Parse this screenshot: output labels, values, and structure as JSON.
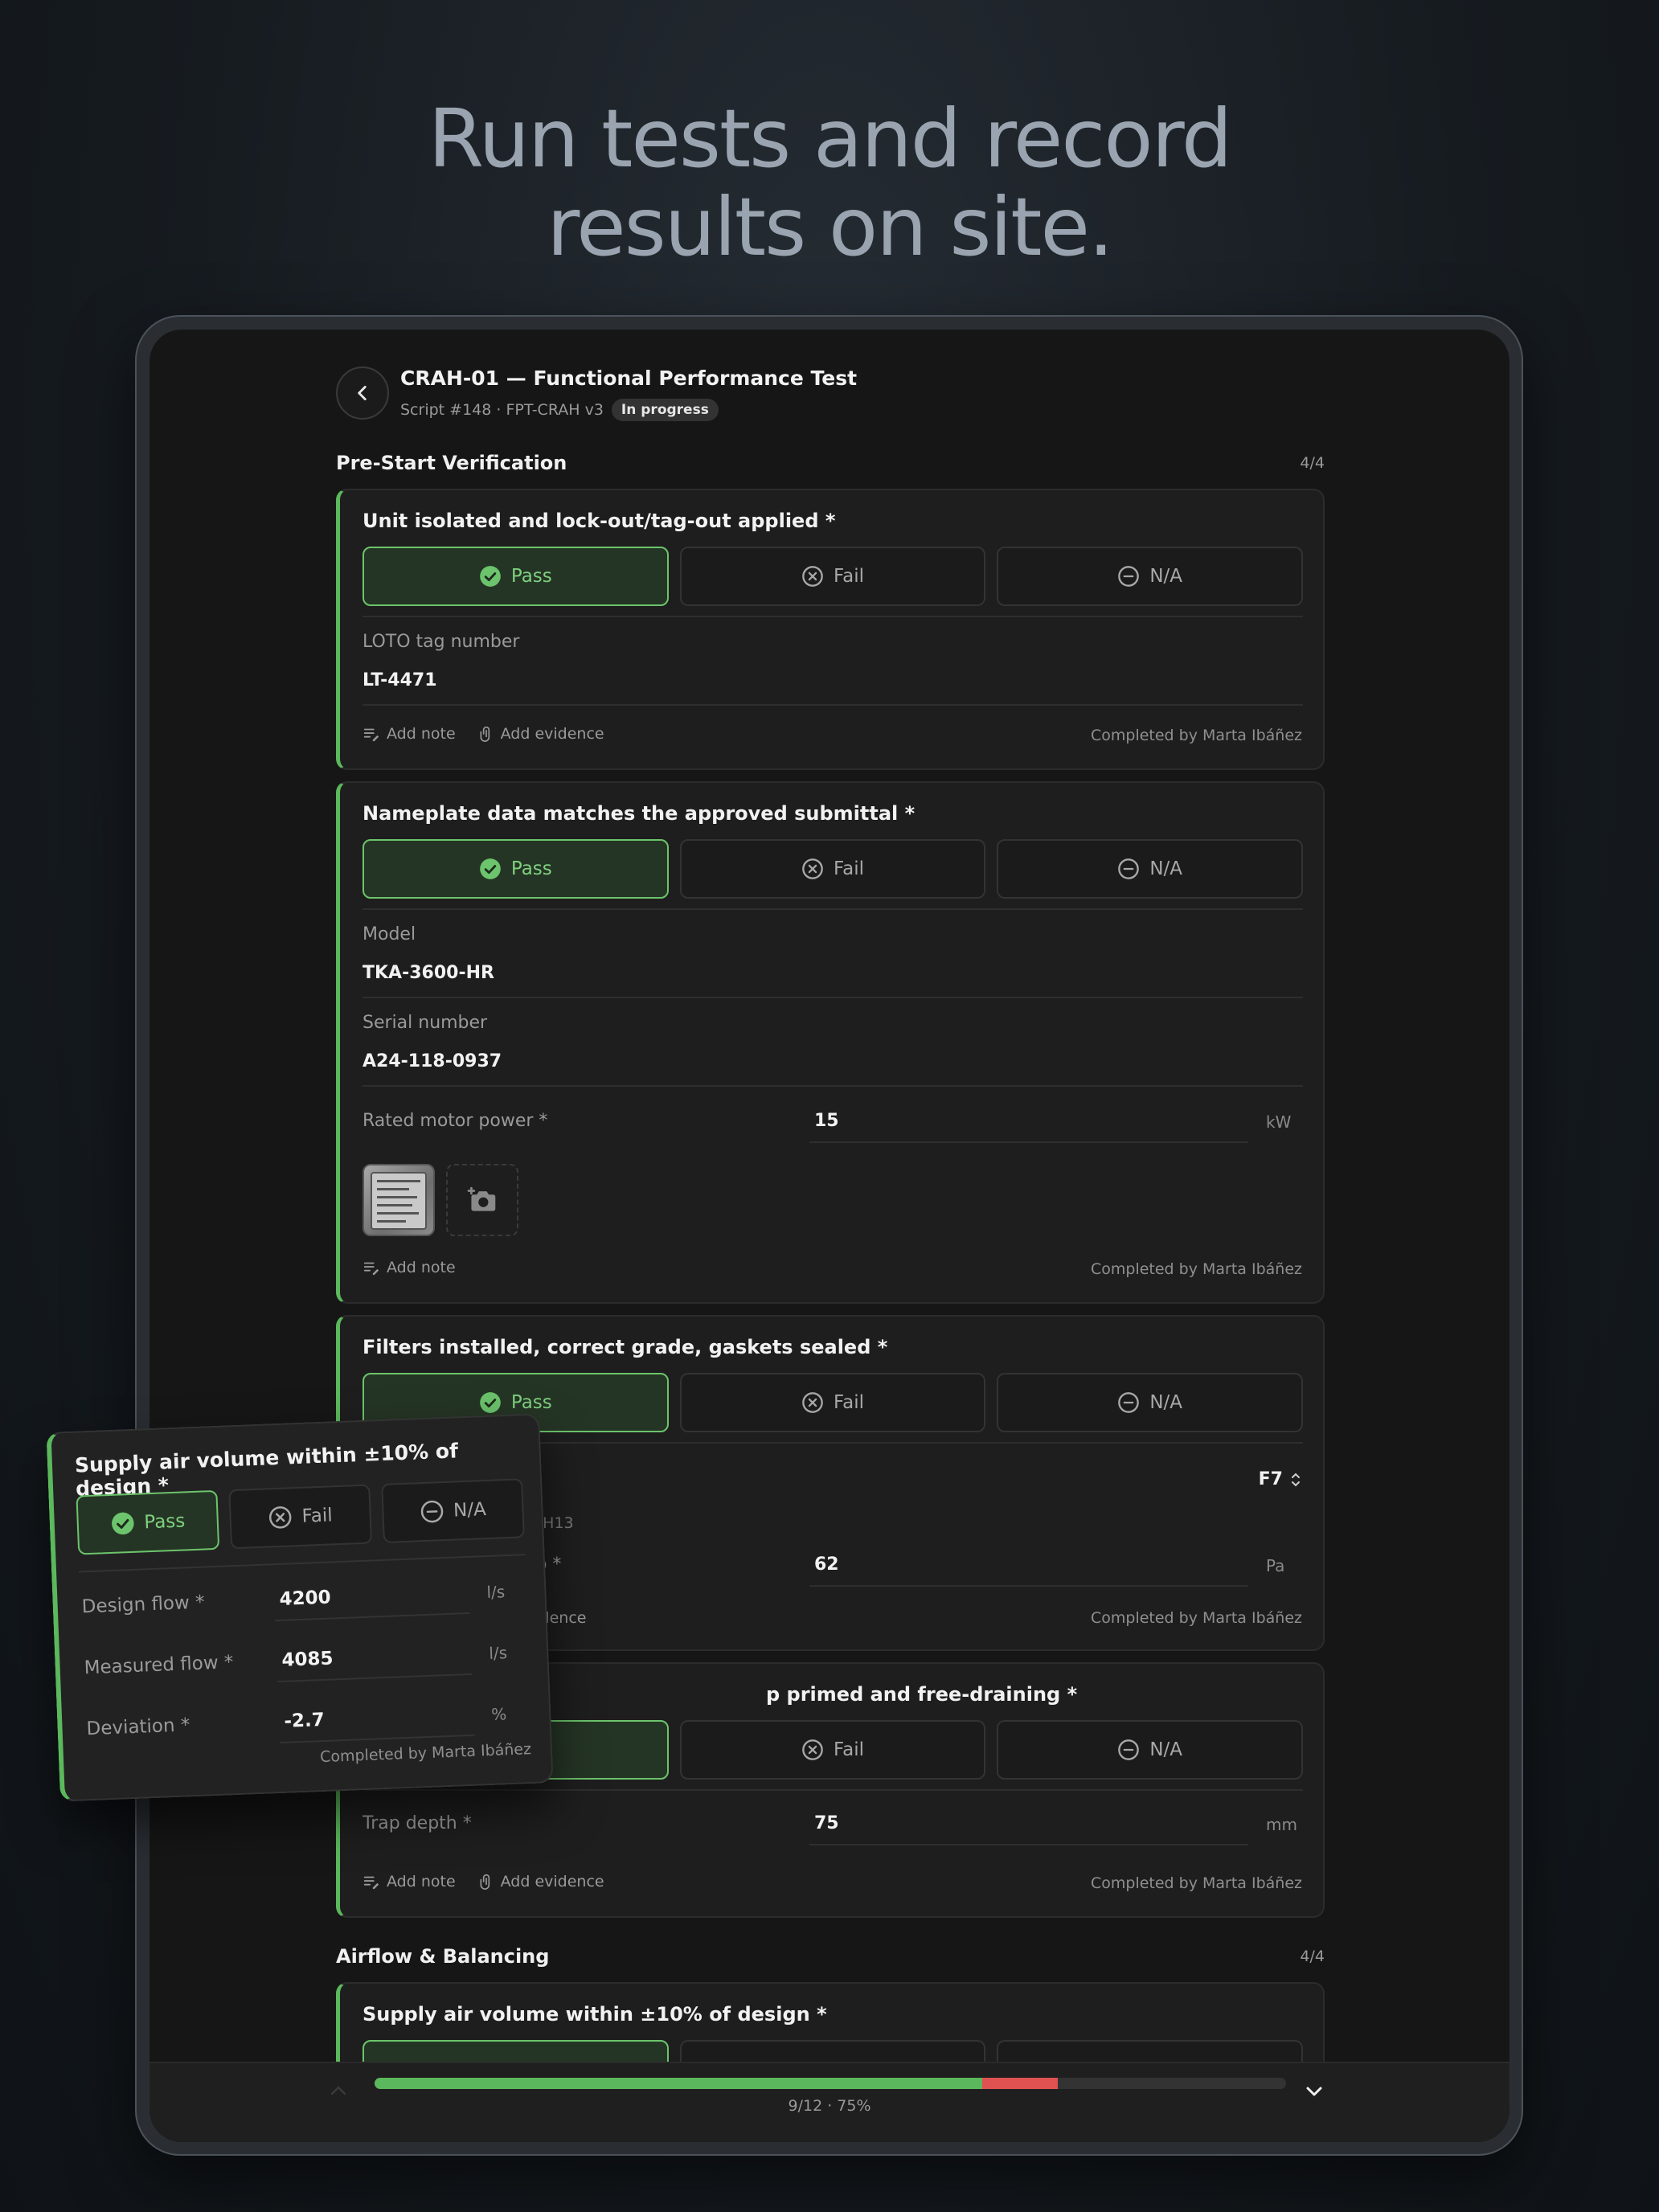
{
  "headline": {
    "line1": "Run tests and record",
    "line2": "results on site."
  },
  "header": {
    "title": "CRAH-01 — Functional Performance Test",
    "script_info": "Script #148 · FPT-CRAH v3",
    "status": "In progress"
  },
  "options": {
    "pass": "Pass",
    "fail": "Fail",
    "na": "N/A"
  },
  "actions": {
    "add_note": "Add note",
    "add_evidence": "Add evidence"
  },
  "completed_by": "Completed by Marta Ibáñez",
  "sections": [
    {
      "name": "Pre-Start Verification",
      "count": "4/4"
    },
    {
      "name": "Airflow & Balancing",
      "count": "4/4"
    }
  ],
  "cards": {
    "loto": {
      "question": "Unit isolated and lock-out/tag-out applied *",
      "selected": "Pass",
      "field_label": "LOTO tag number",
      "field_value": "LT-4471"
    },
    "nameplate": {
      "question": "Nameplate data matches the approved submittal *",
      "selected": "Pass",
      "model_label": "Model",
      "model_value": "TKA-3600-HR",
      "serial_label": "Serial number",
      "serial_value": "A24-118-0937",
      "power_label": "Rated motor power *",
      "power_value": "15",
      "power_unit": "kW"
    },
    "filters": {
      "question": "Filters installed, correct grade, gaskets sealed *",
      "selected": "Pass",
      "grade_value": "F7",
      "grade_hint_partial": "9, H13",
      "pressure_label_partial": "op *",
      "pressure_value": "62",
      "pressure_unit": "Pa",
      "evidence_partial": "vidence"
    },
    "trap": {
      "question_partial": "p primed and free-draining *",
      "selected": "Pass",
      "depth_label": "Trap depth *",
      "depth_value": "75",
      "depth_unit": "mm"
    },
    "supply_peek": {
      "question": "Supply air volume within ±10% of design *"
    }
  },
  "floating_card": {
    "question": "Supply air volume within ±10% of design *",
    "selected": "Pass",
    "design_flow_label": "Design flow *",
    "design_flow_value": "4200",
    "measured_flow_label": "Measured flow *",
    "measured_flow_value": "4085",
    "deviation_label": "Deviation *",
    "deviation_value": "-2.7",
    "flow_unit": "l/s",
    "deviation_unit": "%"
  },
  "progress": {
    "label": "9/12 · 75%",
    "pass_fraction": 0.667,
    "fail_fraction": 0.083
  },
  "colors": {
    "accent_pass": "#5cb85c",
    "fail": "#e05252"
  },
  "icons": [
    "back-arrow-icon",
    "check-circle-icon",
    "x-circle-icon",
    "minus-circle-icon",
    "note-icon",
    "paperclip-icon",
    "camera-plus-icon",
    "select-chevrons-icon",
    "chevron-up-icon",
    "chevron-down-icon"
  ]
}
